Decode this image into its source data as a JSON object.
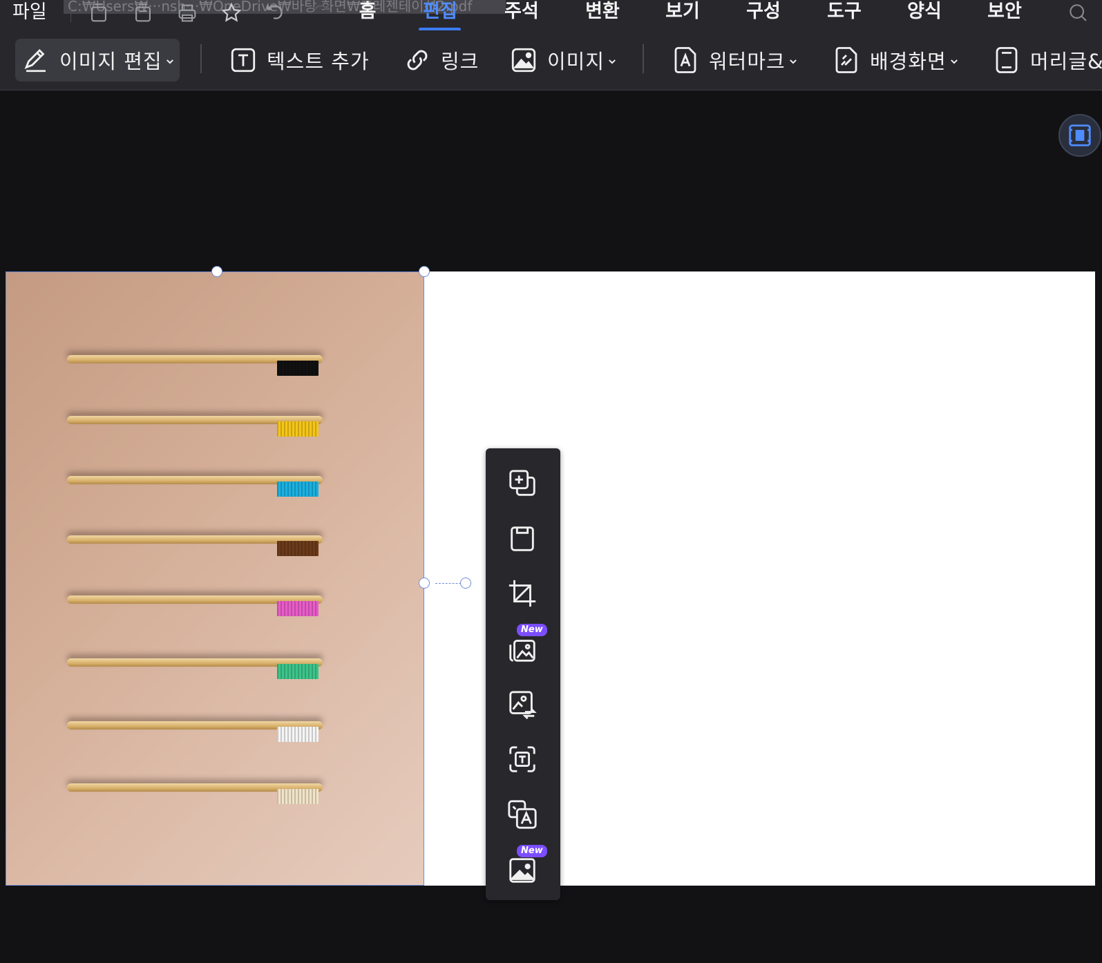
{
  "menubar": {
    "file_label": "파일",
    "path_text": "C:₩Users₩···nsh···₩OneDrive₩바탕 화면₩프레젠테이션2.pdf",
    "tabs": [
      {
        "label": "홈",
        "active": false
      },
      {
        "label": "편집",
        "active": true
      },
      {
        "label": "주석",
        "active": false
      },
      {
        "label": "변환",
        "active": false
      },
      {
        "label": "보기",
        "active": false
      },
      {
        "label": "구성",
        "active": false
      },
      {
        "label": "도구",
        "active": false
      },
      {
        "label": "양식",
        "active": false
      },
      {
        "label": "보안",
        "active": false
      }
    ],
    "quick_access_icons": [
      "new-document-icon",
      "save-icon",
      "print-icon",
      "star-icon",
      "undo-icon",
      "redo-icon"
    ],
    "active_color": "#4f8cff"
  },
  "toolbar": {
    "edit_image_label": "이미지 편집",
    "add_text_label": "텍스트 추가",
    "link_label": "링크",
    "image_label": "이미지",
    "watermark_label": "워터마크",
    "background_label": "배경화면",
    "header_footer_label": "머리글&"
  },
  "image_toolbar": {
    "new_badge": "New",
    "buttons": [
      "add-image-icon",
      "save-image-icon",
      "crop-icon",
      "ai-image-icon",
      "replace-image-icon",
      "ocr-text-icon",
      "translate-icon",
      "ai-image-tool-icon"
    ]
  },
  "photo": {
    "description_colors": [
      "#111111",
      "#f5c518",
      "#1ab0e0",
      "#6b3a1a",
      "#e85cc8",
      "#3cc48a",
      "#f4f4f4",
      "#f1e3c8"
    ]
  }
}
